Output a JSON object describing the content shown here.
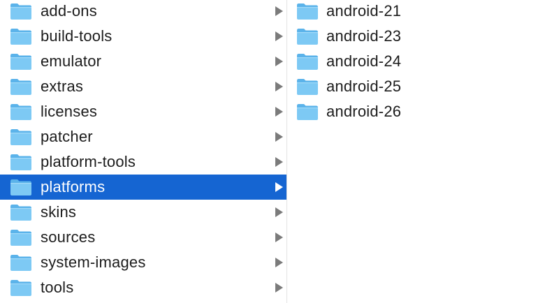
{
  "browser": {
    "left_column": [
      {
        "label": "add-ons",
        "selected": false
      },
      {
        "label": "build-tools",
        "selected": false
      },
      {
        "label": "emulator",
        "selected": false
      },
      {
        "label": "extras",
        "selected": false
      },
      {
        "label": "licenses",
        "selected": false
      },
      {
        "label": "patcher",
        "selected": false
      },
      {
        "label": "platform-tools",
        "selected": false
      },
      {
        "label": "platforms",
        "selected": true
      },
      {
        "label": "skins",
        "selected": false
      },
      {
        "label": "sources",
        "selected": false
      },
      {
        "label": "system-images",
        "selected": false
      },
      {
        "label": "tools",
        "selected": false
      }
    ],
    "right_column": [
      {
        "label": "android-21"
      },
      {
        "label": "android-23"
      },
      {
        "label": "android-24"
      },
      {
        "label": "android-25"
      },
      {
        "label": "android-26"
      }
    ]
  },
  "icons": {
    "folder": "folder-icon",
    "disclosure": "chevron-right-icon"
  },
  "colors": {
    "selection": "#1565d2",
    "folder_front": "#7dc9f4",
    "folder_back": "#5bb3ea",
    "arrow": "#7b7b7b"
  }
}
